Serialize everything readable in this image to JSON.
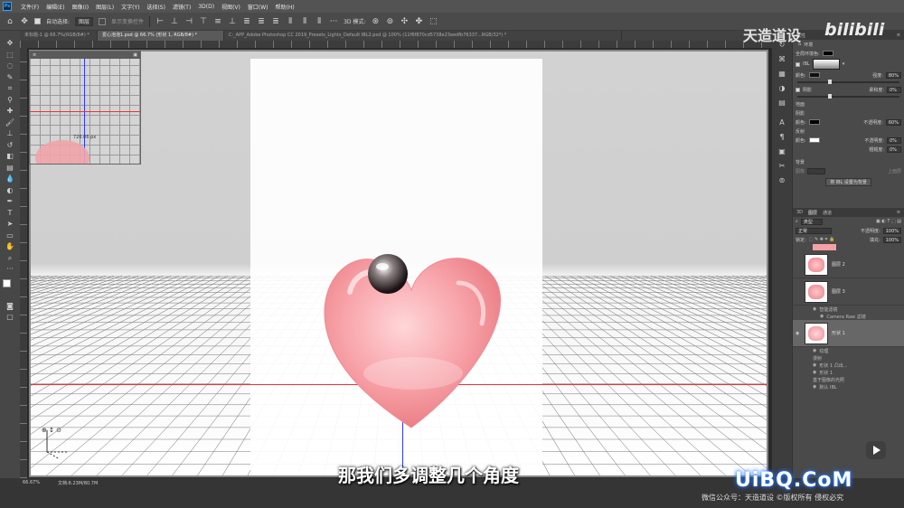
{
  "menu": [
    "文件(F)",
    "编辑(E)",
    "图像(I)",
    "图层(L)",
    "文字(Y)",
    "选择(S)",
    "滤镜(T)",
    "3D(D)",
    "视图(V)",
    "窗口(W)",
    "帮助(H)"
  ],
  "options": {
    "auto_select_label": "自动选择:",
    "auto_select_value": "图层",
    "transform_label": "显示变换控件",
    "mode_3d_label": "3D 模式:"
  },
  "tabs": [
    {
      "label": "未标题-1 @ 66.7%(RGB/8#) *",
      "active": false
    },
    {
      "label": "爱心泡泡1.psd @ 66.7% (形状 1, RGB/8#) *",
      "active": true
    },
    {
      "label": "C:_APP_Adobe Photoshop CC 2019_Presets_Lights_Default IBL2.psd @ 100% (11f6f870cd5738e23eedfb76337...RGB/32*) *",
      "active": false
    }
  ],
  "navigator": {
    "readout": "726.06 px"
  },
  "properties": {
    "panel_title": "环境",
    "global_color_label": "全局环境色:",
    "ibl_label": "IBL",
    "color_label": "颜色:",
    "intensity_label": "强度:",
    "intensity_value": "80%",
    "shadow_label": "阴影",
    "softness_label": "柔和度:",
    "softness_value": "0%",
    "ground_label": "地面",
    "ground_shadow_label": "阴影",
    "ground_shadow_color_label": "颜色:",
    "opacity_label": "不透明度:",
    "opacity_value": "60%",
    "reflection_label": "反射",
    "reflection_color_label": "颜色:",
    "reflection_opacity_label": "不透明度:",
    "reflection_opacity_value": "0%",
    "roughness_label": "粗糙度:",
    "roughness_value": "0%",
    "background_label": "背景",
    "image_label": "图像",
    "new_bg_label": "上面层",
    "ibl_as_bg_button": "将 IBL 设置为背景"
  },
  "layers": {
    "tabs": [
      "3D",
      "图层",
      "通道"
    ],
    "filter_label": "类型",
    "blend_mode": "正常",
    "opacity_label": "不透明度:",
    "opacity_value": "100%",
    "lock_label": "锁定:",
    "fill_label": "填充:",
    "fill_value": "100%",
    "items": [
      {
        "name": "图层 2",
        "selected": false
      },
      {
        "name": "图层 3",
        "selected": false
      },
      {
        "name": "形状 1",
        "selected": true
      }
    ],
    "sub_items": [
      "智能滤镜",
      "Camera Raw 滤镜",
      "纹理",
      "漫射",
      "形状 1 凸出...",
      "形状 1",
      "基于图像的光照",
      "默认 IBL"
    ]
  },
  "status": {
    "zoom": "66.67%",
    "doc": "文档:6.23M/80.7M"
  },
  "overlay": {
    "subtitle": "那我们多调整几个角度",
    "watermark_top": "天造道设",
    "watermark_bili": "bilibili",
    "watermark_site": "UiBQ.CoM",
    "watermark_bottom": "微信公众号：天造道设   ©版权所有 侵权必究"
  }
}
